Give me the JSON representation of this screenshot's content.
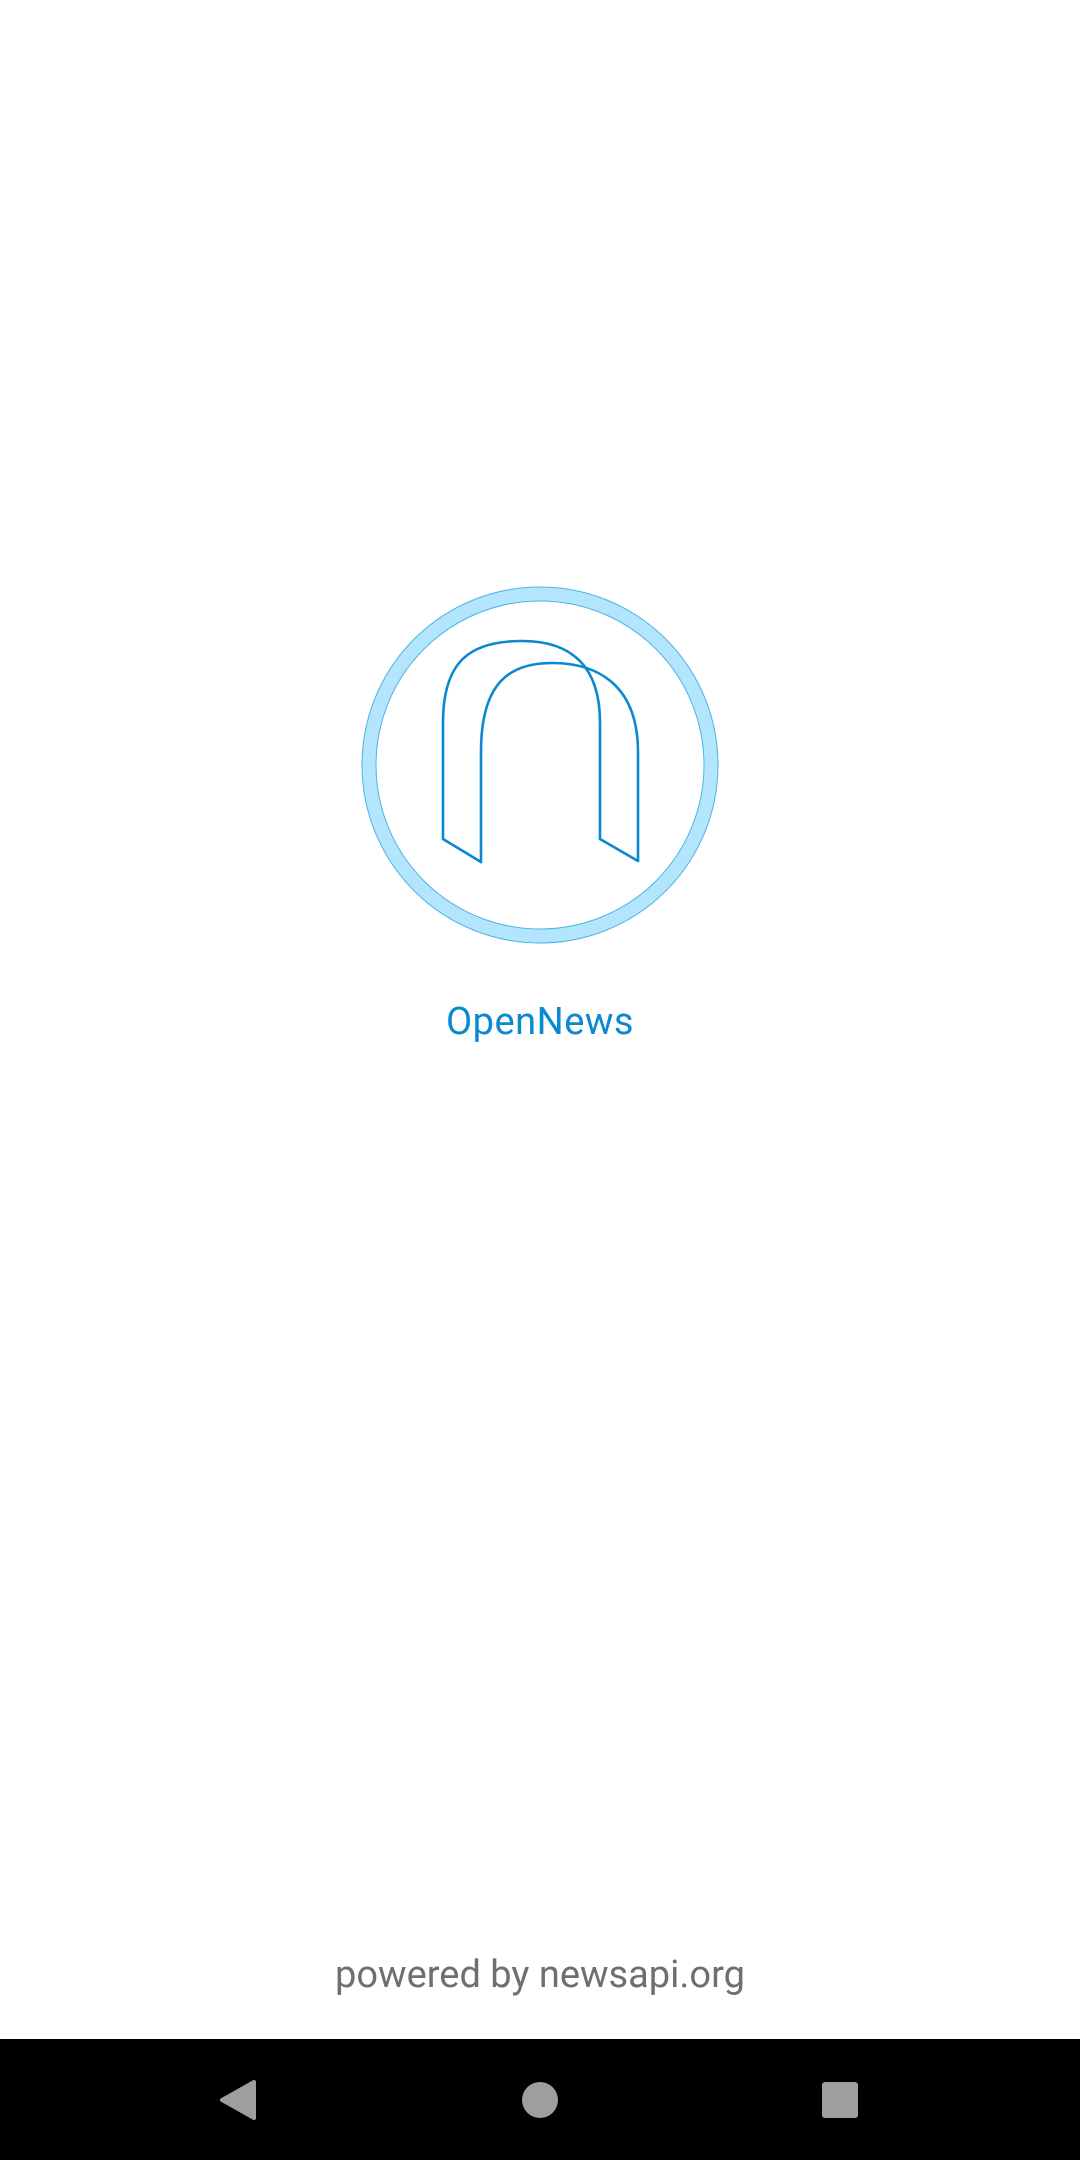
{
  "app": {
    "name": "OpenNews",
    "footer": "powered by newsapi.org"
  },
  "icons": {
    "logo": "opennews-logo-icon",
    "back": "back-triangle-icon",
    "home": "home-circle-icon",
    "recent": "recent-apps-square-icon"
  },
  "colors": {
    "brand": "#0a89d0",
    "ring": "#b3e5fc",
    "footer_text": "#6f6f6f",
    "navbar": "#000000",
    "nav_icons": "#9e9e9e"
  }
}
